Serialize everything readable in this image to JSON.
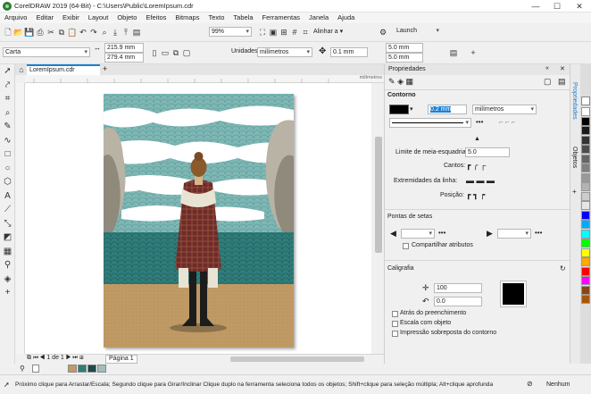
{
  "window": {
    "title": "CorelDRAW 2019 (64-Bit) - C:\\Users\\Public\\LoremIpsum.cdr",
    "minimize": "—",
    "maximize": "☐",
    "close": "✕"
  },
  "menu": [
    "Arquivo",
    "Editar",
    "Exibir",
    "Layout",
    "Objeto",
    "Efeitos",
    "Bitmaps",
    "Texto",
    "Tabela",
    "Ferramentas",
    "Janela",
    "Ajuda"
  ],
  "toolbar1": {
    "zoom": "99%",
    "align": "Alinhar a",
    "launch": "Launch"
  },
  "propbar": {
    "page_preset": "Carta",
    "width": "215.9 mm",
    "height": "279.4 mm",
    "units_label": "Unidades:",
    "units": "milímetros",
    "nudge": "0.1 mm",
    "dup_x": "5.0 mm",
    "dup_y": "5.0 mm"
  },
  "document_tab": "LoremIpsum.cdr",
  "add_tab": "+",
  "ruler": {
    "unit": "milímetros"
  },
  "pages": {
    "current": "1",
    "of": "de",
    "total": "1",
    "tab": "Página 1"
  },
  "status": {
    "hint": "Próximo clique para Arrastar/Escala; Segundo clique para Girar/Inclinar Clique duplo na ferramenta seleciona todos os objetos; Shift+clique para seleção múltipla; Alt+clique aprofunda",
    "fill": "Nenhum"
  },
  "panel": {
    "title": "Propriedades",
    "contorno": {
      "heading": "Contorno",
      "width": "0.2 mm",
      "units": "milímetros",
      "miter_label": "Limite de meia-esquadria:",
      "miter": "5.0",
      "corners": "Cantos:",
      "line_ends": "Extremidades da linha:",
      "position": "Posição:"
    },
    "arrows": {
      "heading": "Pontas de setas",
      "share": "Compartilhar atributos"
    },
    "calligraphy": {
      "heading": "Caligrafia",
      "stretch": "100",
      "angle": "0.0",
      "behind_fill": "Atrás do preenchimento",
      "scale": "Escala com objeto",
      "overprint": "Impressão sobreposta do contorno"
    }
  },
  "dock_tabs": [
    "Propriedades",
    "Objetos"
  ],
  "colors": {
    "accent": "#1f7fd1",
    "sea": "#2f7d7b",
    "sky_pattern": "#7fb7b5",
    "sand": "#bf9a64",
    "coat": "#6e2b2a"
  },
  "palette": [
    "#ffffff",
    "#000000",
    "#1a1a1a",
    "#333333",
    "#4d4d4d",
    "#666666",
    "#808080",
    "#999999",
    "#b3b3b3",
    "#cccccc",
    "#e6e6e6",
    "#0000ff",
    "#00aaff",
    "#00ffff",
    "#00ff00",
    "#ffff00",
    "#ffaa00",
    "#ff0000",
    "#ff00ff",
    "#8b4513",
    "#aa5500"
  ],
  "doc_palette": [
    "#c49a62",
    "#2f7d7b",
    "#1e4a4a",
    "#9ebfbd"
  ]
}
